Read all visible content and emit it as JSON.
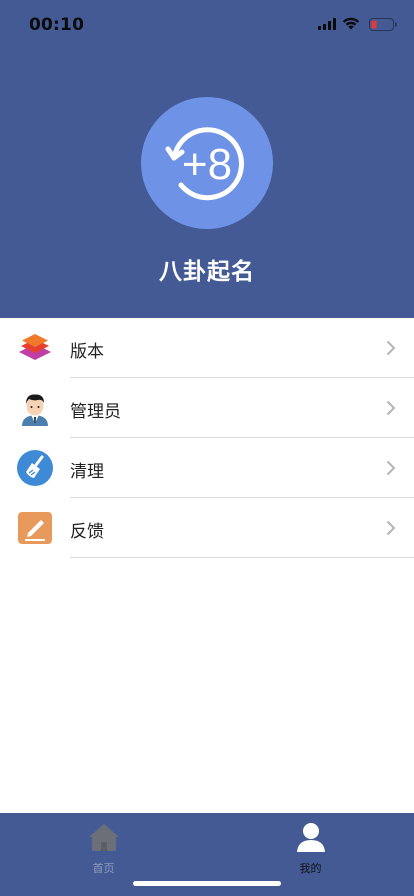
{
  "status_bar": {
    "time": "00:10"
  },
  "profile": {
    "app_name": "八卦起名",
    "logo_text": "+8"
  },
  "menu": {
    "items": [
      {
        "label": "版本",
        "icon": "layers-icon"
      },
      {
        "label": "管理员",
        "icon": "admin-avatar-icon"
      },
      {
        "label": "清理",
        "icon": "broom-icon"
      },
      {
        "label": "反馈",
        "icon": "edit-pencil-icon"
      }
    ]
  },
  "tabbar": {
    "tabs": [
      {
        "label": "首页",
        "icon": "home-icon",
        "active": false
      },
      {
        "label": "我的",
        "icon": "user-icon",
        "active": true
      }
    ]
  },
  "colors": {
    "header_bg": "#435a95",
    "logo_bg": "#6e93e6",
    "tabbar_bg": "#435a95"
  }
}
